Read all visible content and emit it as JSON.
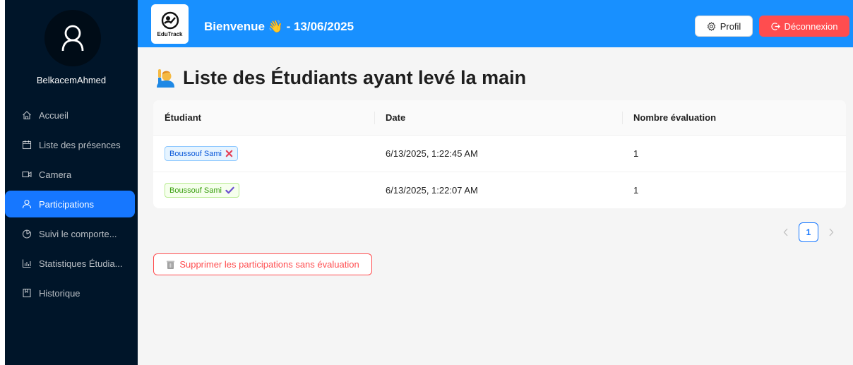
{
  "sidebar": {
    "username": "BelkacemAhmed",
    "items": [
      {
        "label": "Accueil",
        "icon": "home-icon"
      },
      {
        "label": "Liste des présences",
        "icon": "calendar-icon"
      },
      {
        "label": "Camera",
        "icon": "video-camera-icon"
      },
      {
        "label": "Participations",
        "icon": "user-icon",
        "active": true
      },
      {
        "label": "Suivi le comporte...",
        "icon": "pie-chart-icon"
      },
      {
        "label": "Statistiques Étudia...",
        "icon": "bar-chart-icon"
      },
      {
        "label": "Historique",
        "icon": "book-icon"
      }
    ]
  },
  "header": {
    "logo_text": "EduTrack",
    "welcome": "Bienvenue 👋 - 13/06/2025",
    "profil_label": "Profil",
    "logout_label": "Déconnexion"
  },
  "main": {
    "title": "Liste des Étudiants ayant levé la main",
    "table": {
      "columns": [
        "Étudiant",
        "Date",
        "Nombre évaluation"
      ],
      "rows": [
        {
          "student": "Boussouf Sami",
          "status": "cross",
          "date": "6/13/2025, 1:22:45 AM",
          "count": "1"
        },
        {
          "student": "Boussouf Sami",
          "status": "check",
          "date": "6/13/2025, 1:22:07 AM",
          "count": "1"
        }
      ]
    },
    "pagination": {
      "current_page": "1"
    },
    "delete_button_label": "Supprimer les participations sans évaluation"
  },
  "colors": {
    "sidebar_bg": "#001529",
    "header_bg": "#1890ff",
    "active_item": "#1677ff",
    "danger": "#ff4d4f"
  }
}
